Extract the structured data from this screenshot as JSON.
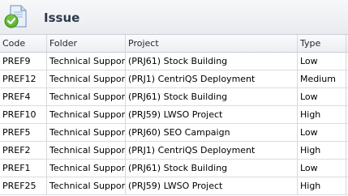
{
  "panel": {
    "title": "Issue",
    "icon": "issue-document-check-icon"
  },
  "columns": [
    "Code",
    "Folder",
    "Project",
    "Type"
  ],
  "rows": [
    [
      "PREF9",
      "Technical Support",
      "(PRJ61) Stock Building",
      "Low"
    ],
    [
      "PREF12",
      "Technical Support",
      "(PRJ1) CentriQS Deployment",
      "Medium"
    ],
    [
      "PREF4",
      "Technical Support",
      "(PRJ61) Stock Building",
      "Low"
    ],
    [
      "PREF10",
      "Technical Support",
      "(PRJ59) LWSO Project",
      "High"
    ],
    [
      "PREF5",
      "Technical Support",
      "(PRJ60) SEO Campaign",
      "Low"
    ],
    [
      "PREF2",
      "Technical Support",
      "(PRJ1) CentriQS Deployment",
      "High"
    ],
    [
      "PREF1",
      "Technical Support",
      "(PRJ61) Stock Building",
      "Low"
    ],
    [
      "PREF25",
      "Technical Support",
      "(PRJ59) LWSO Project",
      "High"
    ]
  ],
  "colors": {
    "header_bg": "#eceef1",
    "grid_line": "#d5d8dd",
    "title_text": "#2d3a4b",
    "icon_check": "#5db532"
  }
}
